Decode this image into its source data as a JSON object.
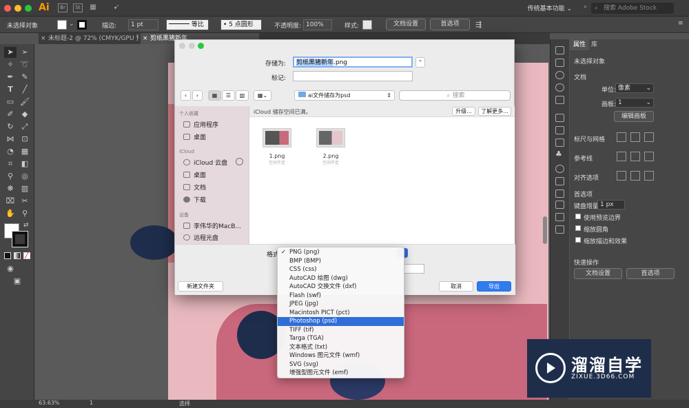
{
  "app": {
    "logo": "Ai",
    "icon_br": "Br",
    "icon_st": "St",
    "workspace": "传统基本功能",
    "stock_search_placeholder": "搜索 Adobe Stock"
  },
  "controlbar": {
    "selection": "未选择对象",
    "stroke_label": "描边:",
    "stroke_value": "1 pt",
    "profile": "等比",
    "brush": "5 点圆形",
    "opacity_label": "不透明度:",
    "opacity_value": "100%",
    "style_label": "样式:",
    "doc_setup": "文档设置",
    "preferences": "首选项"
  },
  "tabs": [
    {
      "label": "未标题-2 @ 72% (CMYK/GPU 预览)"
    },
    {
      "label": "剪纸黑猪新年"
    }
  ],
  "dialog": {
    "save_as_label": "存储为:",
    "filename": "剪纸黑猪新年.png",
    "filename_selected": "剪纸黑猪新年",
    "filename_ext": ".png",
    "tags_label": "标记:",
    "location": "ai文件储存为psd",
    "search_placeholder": "搜索",
    "sidebar": {
      "personal_header": "个人收藏",
      "apps": "应用程序",
      "desktop": "桌面",
      "icloud_header": "iCloud",
      "icloud_drive": "iCloud 云盘",
      "icloud_desktop": "桌面",
      "documents": "文档",
      "downloads": "下载",
      "devices_header": "设备",
      "macbook": "李伟华的MacB...",
      "remote_disc": "远程光盘"
    },
    "icloud_full": "iCloud 储存空间已满。",
    "upgrade": "升级...",
    "learn_more": "了解更多...",
    "files": [
      {
        "name": "1.png",
        "sub": "空间不足"
      },
      {
        "name": "2.png",
        "sub": "空间不足"
      }
    ],
    "format_label": "格式",
    "new_folder": "新建文件夹",
    "cancel": "取消",
    "export": "导出"
  },
  "format_menu": {
    "selected": "PNG (png)",
    "highlighted": "Photoshop (psd)",
    "items": [
      "PNG (png)",
      "BMP (BMP)",
      "CSS (css)",
      "AutoCAD 绘图 (dwg)",
      "AutoCAD 交换文件 (dxf)",
      "Flash (swf)",
      "JPEG (jpg)",
      "Macintosh PICT (pct)",
      "Photoshop (psd)",
      "TIFF (tif)",
      "Targa (TGA)",
      "文本格式 (txt)",
      "Windows 图元文件 (wmf)",
      "SVG (svg)",
      "增强型图元文件 (emf)"
    ]
  },
  "panel": {
    "tab_properties": "属性",
    "tab_libraries": "库",
    "no_selection": "未选择对象",
    "document": "文档",
    "units_label": "单位:",
    "units_value": "像素",
    "artboard_label": "画板:",
    "artboard_value": "1",
    "edit_artboards": "编辑画板",
    "rulers_grids": "标尺与网格",
    "guides": "参考线",
    "align_options": "对齐选项",
    "preferences": "首选项",
    "keyboard_increment_label": "键盘增量:",
    "keyboard_increment_value": "1 px",
    "use_preview_bounds": "使用预览边界",
    "scale_corners": "缩放圆角",
    "scale_strokes": "缩放描边和效果",
    "quick_actions": "快速操作",
    "doc_setup": "文档设置",
    "prefs_button": "首选项"
  },
  "status": {
    "zoom": "63.63%",
    "artboard": "1",
    "mode": "选择"
  },
  "watermark": {
    "title": "溜溜自学",
    "url": "ZIXUE.3D66.COM"
  },
  "colors": {
    "accent_blue": "#2f6ed8",
    "ai_orange": "#ff9a00",
    "artboard_pink": "#e9b9bf"
  }
}
